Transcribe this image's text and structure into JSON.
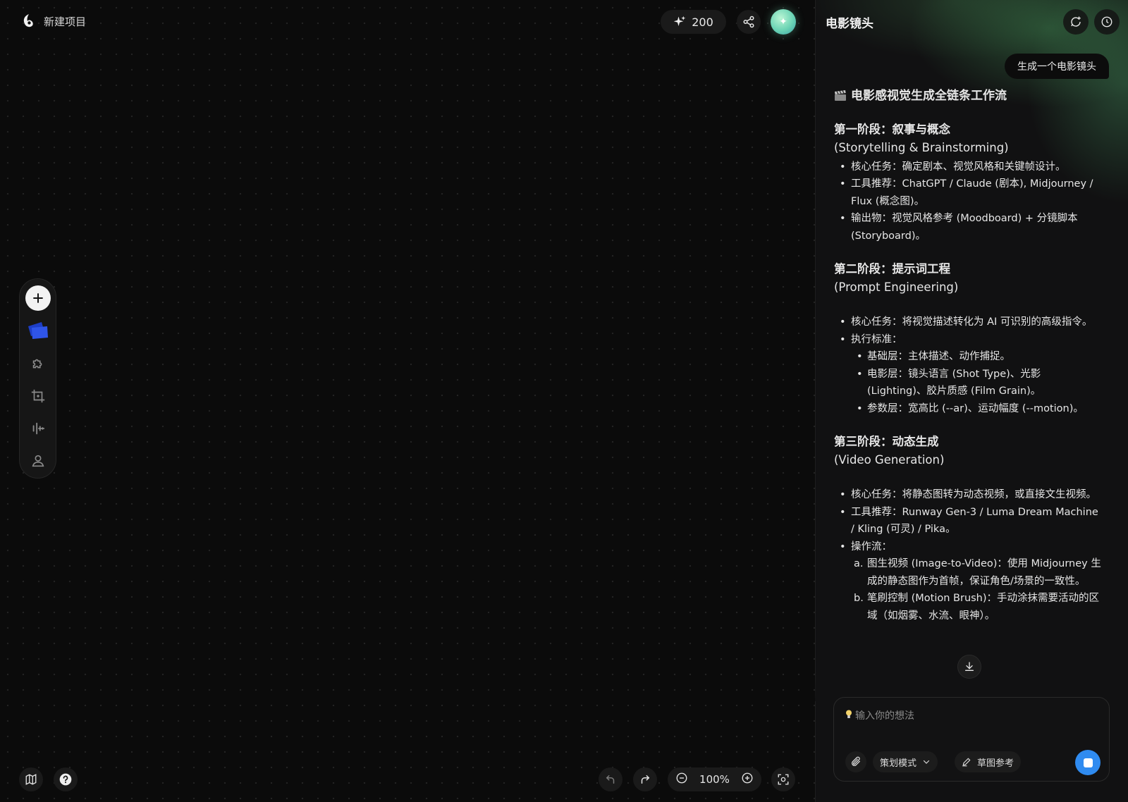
{
  "project": {
    "title": "新建项目"
  },
  "header": {
    "credits": "200",
    "accent": "#6bd3b4"
  },
  "rail": {
    "items": [
      "add-icon",
      "media-icon",
      "plugin-icon",
      "crop-icon",
      "audio-icon",
      "person-icon"
    ],
    "media_color": "#2f55e8"
  },
  "bottom": {
    "zoom": "100%"
  },
  "chat": {
    "title": "电影镜头",
    "user_message": "生成一个电影镜头",
    "heading": "电影感视觉生成全链条工作流",
    "stage1": {
      "title": "第一阶段：叙事与概念",
      "subtitle": "(Storytelling & Brainstorming)",
      "bullets": [
        "核心任务：确定剧本、视觉风格和关键帧设计。",
        "工具推荐：ChatGPT / Claude (剧本), Midjourney / Flux (概念图)。",
        "输出物：视觉风格参考 (Moodboard) + 分镜脚本 (Storyboard)。"
      ]
    },
    "stage2": {
      "title": "第二阶段：提示词工程",
      "subtitle": "(Prompt Engineering)",
      "bullet1": "核心任务：将视觉描述转化为 AI 可识别的高级指令。",
      "bullet2": "执行标准：",
      "sub_bullets": [
        "基础层：主体描述、动作捕捉。",
        "电影层：镜头语言 (Shot Type)、光影 (Lighting)、胶片质感 (Film Grain)。",
        "参数层：宽高比 (--ar)、运动幅度 (--motion)。"
      ]
    },
    "stage3": {
      "title": "第三阶段：动态生成",
      "subtitle": "(Video Generation)",
      "bullets": [
        "核心任务：将静态图转为动态视频，或直接文生视频。",
        "工具推荐：Runway Gen-3 / Luma Dream Machine / Kling (可灵) / Pika。",
        "操作流："
      ],
      "steps": [
        {
          "marker": "a.",
          "text": "图生视频 (Image-to-Video)：使用 Midjourney 生成的静态图作为首帧，保证角色/场景的一致性。"
        },
        {
          "marker": "b.",
          "text": "笔刷控制 (Motion Brush)：手动涂抹需要活动的区域（如烟雾、水流、眼神）。"
        }
      ]
    },
    "composer": {
      "placeholder": "输入你的想法",
      "mode": "策划模式",
      "sketch": "草图参考",
      "send_color": "#2f8bf0"
    }
  }
}
